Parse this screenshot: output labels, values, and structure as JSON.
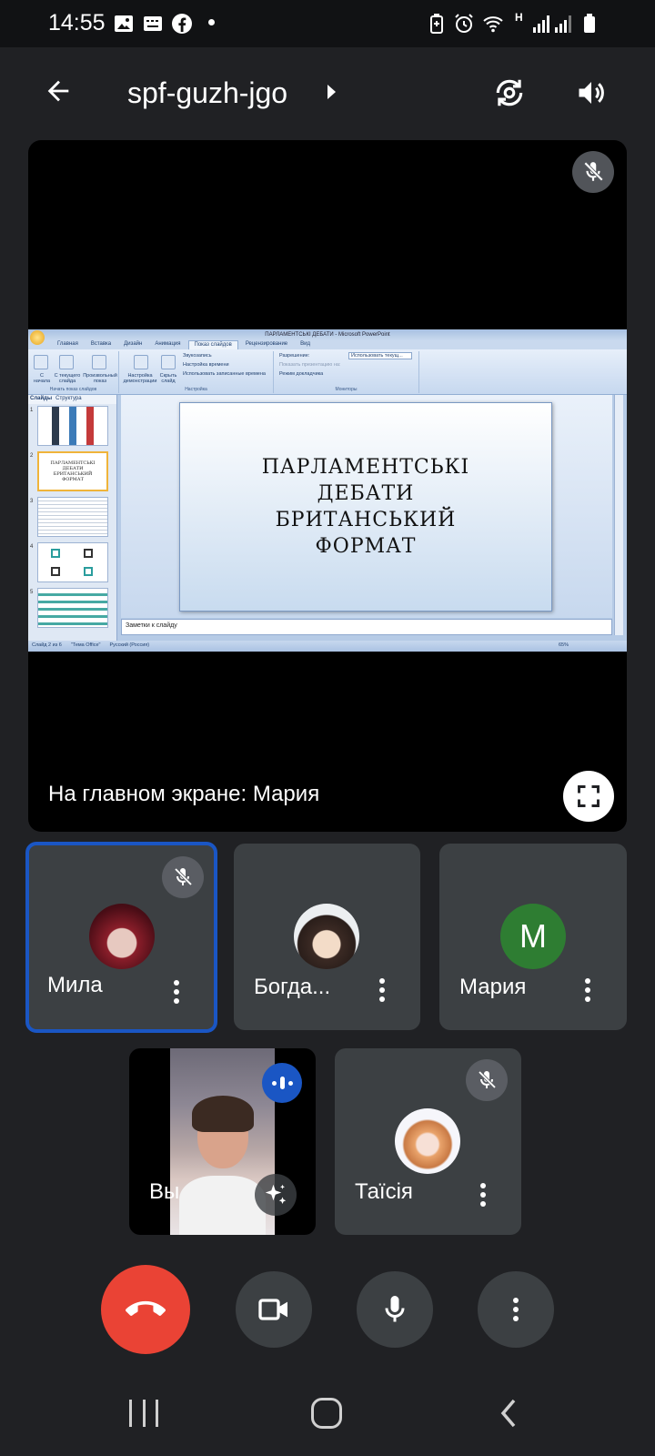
{
  "status_bar": {
    "time": "14:55",
    "network_type": "H"
  },
  "top_bar": {
    "meeting_code": "spf-guzh-jgo"
  },
  "stage": {
    "caption": "На главном экране: Мария",
    "shared_screen": {
      "window_title": "ПАРЛАМЕНТСЬКІ ДЕБАТИ - Microsoft PowerPoint",
      "tabs": [
        "Главная",
        "Вставка",
        "Дизайн",
        "Анимация",
        "Показ слайдов",
        "Рецензирование",
        "Вид"
      ],
      "active_tab": "Показ слайдов",
      "ribbon": {
        "group1_label": "Начать показ слайдов",
        "group2_label": "Настройка",
        "group3_label": "Мониторы",
        "btn_from_start": "С начала",
        "btn_from_current": "С текущего слайда",
        "btn_custom_show": "Произвольный показ",
        "btn_setup": "Настройка демонстрации",
        "btn_hide": "Скрыть слайд",
        "opt_record": "Звукозапись",
        "opt_timings": "Настройка времени",
        "opt_use_timings": "Использовать записанные времена",
        "opt_resolution": "Разрешение:",
        "opt_resolution_value": "Использовать текущ...",
        "opt_show_on": "Показать презентацию на:",
        "opt_presenter": "Режим докладчика"
      },
      "slides_panel_tabs": [
        "Слайды",
        "Структура"
      ],
      "slide_title": "ПАРЛАМЕНТСЬКІ\nДЕБАТИ\nБРИТАНСЬКИЙ\nФОРМАТ",
      "thumb2_title": "ПАРЛАМЕНТСЬКІ ДЕБАТИ БРИТАНСЬКИЙ ФОРМАТ",
      "notes_placeholder": "Заметки к слайду",
      "status": {
        "slide_counter": "Слайд 2 из 6",
        "theme": "\"Тема Office\"",
        "language": "Русский (Россия)",
        "zoom": "65%"
      }
    }
  },
  "participants": [
    {
      "name": "Мила",
      "muted": true,
      "speaking": true
    },
    {
      "name": "Богда...",
      "muted": false
    },
    {
      "name": "Мария",
      "initial": "M",
      "avatar_color": "#2e7d32",
      "muted": false
    },
    {
      "name": "Вы",
      "muted": false,
      "self": true
    },
    {
      "name": "Таїсія",
      "muted": true
    }
  ],
  "colors": {
    "background": "#202124",
    "tile": "#3c4043",
    "speaking_border": "#1a56c4",
    "end_call": "#ea4335",
    "control_button": "#3c4043"
  }
}
